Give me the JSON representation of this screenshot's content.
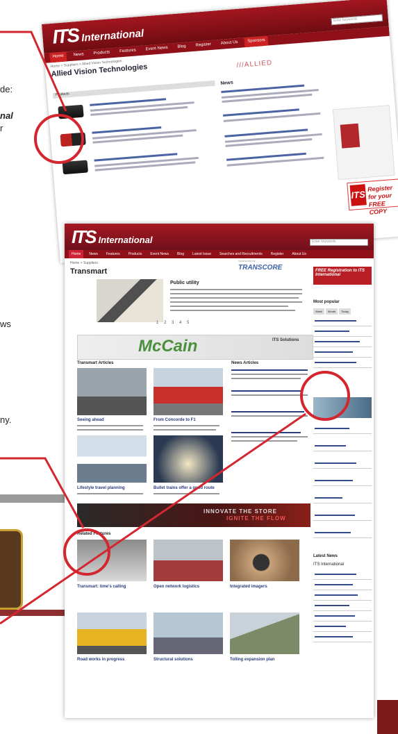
{
  "side_texts": {
    "line1": "de:",
    "line2": "nal",
    "line3": "r",
    "line4": "ws",
    "line5": "ny."
  },
  "page1": {
    "logo_its": "ITS",
    "logo_international": "International",
    "nav": [
      "Home",
      "News",
      "Products",
      "Features",
      "Event News",
      "Blog",
      "Register",
      "About Us",
      "Sponsors"
    ],
    "search_placeholder": "Enter keywords",
    "breadcrumb": "Home > Suppliers > Allied Vision Technologies",
    "company_name": "Allied Vision Technologies",
    "allied_logo": "///ALLIED",
    "products_header": "Products",
    "news_header": "News",
    "register_line1": "Register for your",
    "register_line2": "FREE COPY",
    "register_mark": "ITS"
  },
  "page2": {
    "logo_its": "ITS",
    "logo_international": "International",
    "nav": [
      "Home",
      "News",
      "Features",
      "Products",
      "Event News",
      "Blog",
      "Latest Issue",
      "Searches and Recruitments",
      "Register",
      "About Us"
    ],
    "search_placeholder": "Enter keywords",
    "breadcrumb": "Home > Suppliers",
    "page_title": "Transmart",
    "sponsor_label": "Sponsored by",
    "sponsor_logo": "TRANSCORE",
    "featured_title": "Public utility",
    "pager": "1 2 3 4 5",
    "mccain_logo": "McCain",
    "its_solutions": "ITS Solutions",
    "transmart_articles": "Transmart Articles",
    "news_articles": "News Articles",
    "articles": [
      "Seeing ahead",
      "From Concorde to F1",
      "Lifestyle travel planning",
      "Bullet trains offer a good route"
    ],
    "banner_line1": "INNOVATE THE STORE",
    "banner_line2": "IGNITE THE FLOW",
    "related_features": "Related Features",
    "bottom_articles": [
      "Transmart: time's calling",
      "Open network logistics",
      "Integrated imagers",
      "Road works in progress",
      "Structural solutions",
      "Tolling expansion plan"
    ],
    "free_registration": "FREE Registration to ITS International",
    "most_popular": "Most popular",
    "pop_tabs": [
      "Week",
      "Month",
      "Today"
    ],
    "latest_news": "Latest News",
    "its_international": "ITS International"
  },
  "colors": {
    "its_red": "#a31620",
    "callout_red": "#d4262e",
    "link_blue": "#2b3c7a"
  }
}
